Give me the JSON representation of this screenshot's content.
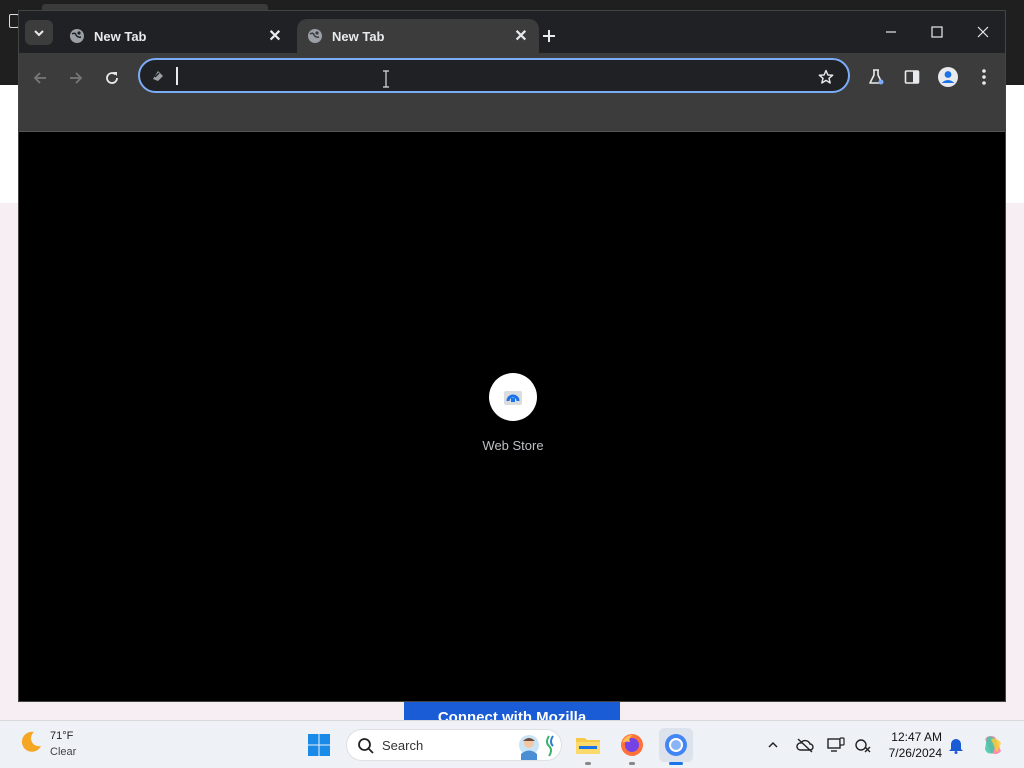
{
  "tabs": [
    {
      "title": "New Tab",
      "active": false
    },
    {
      "title": "New Tab",
      "active": true
    }
  ],
  "omnibox": {
    "value": "",
    "placeholder": ""
  },
  "shortcuts": [
    {
      "label": "Web Store"
    }
  ],
  "background_button": {
    "label": "Connect with Mozilla"
  },
  "taskbar": {
    "weather": {
      "temperature": "71°F",
      "condition": "Clear"
    },
    "search_label": "Search",
    "clock": {
      "time": "12:47 AM",
      "date": "7/26/2024"
    }
  },
  "colors": {
    "tabstrip": "#202124",
    "toolbar": "#3c3c3c",
    "omnibox_focus": "#7cacf8",
    "taskbar": "#eef1f6",
    "mozilla_button": "#1a5bd6"
  }
}
